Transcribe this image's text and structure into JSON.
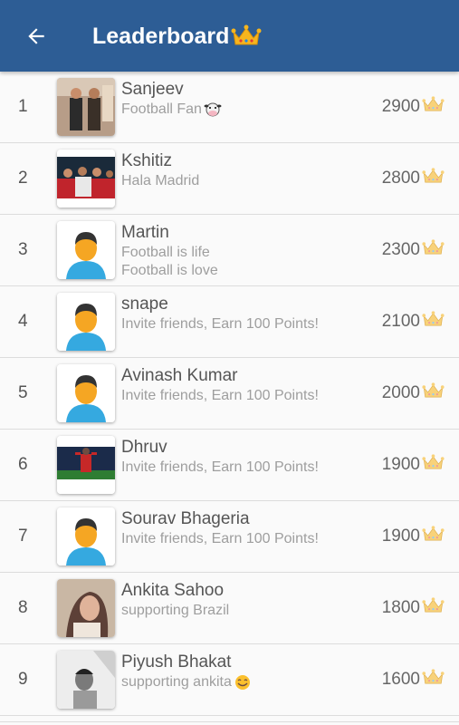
{
  "header": {
    "title": "Leaderboard",
    "back_icon": "arrow-left-icon",
    "title_icon": "crown-icon",
    "background": "#2d5d95"
  },
  "rows": [
    {
      "rank": "1",
      "name": "Sanjeev",
      "status": "Football Fan",
      "status_emoji": "cow-face-icon",
      "points": "2900",
      "avatar": "photo-two-men"
    },
    {
      "rank": "2",
      "name": "Kshitiz",
      "status": "Hala Madrid",
      "points": "2800",
      "avatar": "photo-football-team"
    },
    {
      "rank": "3",
      "name": "Martin",
      "status": "Football is life\nFootball is love",
      "points": "2300",
      "avatar": "default-person"
    },
    {
      "rank": "4",
      "name": "snape",
      "status": "Invite friends, Earn 100 Points!",
      "points": "2100",
      "avatar": "default-person"
    },
    {
      "rank": "5",
      "name": "Avinash Kumar",
      "status": "Invite friends, Earn 100 Points!",
      "points": "2000",
      "avatar": "default-person"
    },
    {
      "rank": "6",
      "name": "Dhruv",
      "status": "Invite friends, Earn 100 Points!",
      "points": "1900",
      "avatar": "photo-football-player"
    },
    {
      "rank": "7",
      "name": "Sourav Bhageria",
      "status": "Invite friends, Earn 100 Points!",
      "points": "1900",
      "avatar": "default-person"
    },
    {
      "rank": "8",
      "name": "Ankita Sahoo",
      "status": "supporting Brazil",
      "points": "1800",
      "avatar": "photo-woman"
    },
    {
      "rank": "9",
      "name": "Piyush Bhakat",
      "status": "supporting ankita",
      "status_emoji": "smiling-face-icon",
      "points": "1600",
      "avatar": "photo-man-bw"
    }
  ]
}
